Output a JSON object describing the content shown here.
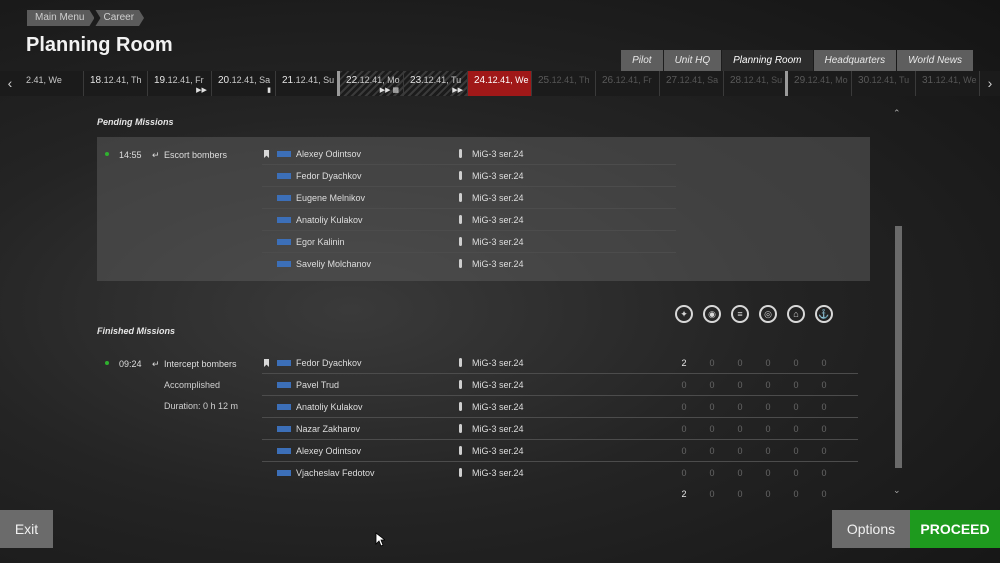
{
  "breadcrumb": [
    "Main Menu",
    "Career"
  ],
  "title": "Planning Room",
  "tabs": [
    {
      "label": "Pilot",
      "active": false
    },
    {
      "label": "Unit HQ",
      "active": false
    },
    {
      "label": "Planning Room",
      "active": true
    },
    {
      "label": "Headquarters",
      "active": false
    },
    {
      "label": "World News",
      "active": false
    }
  ],
  "timeline": {
    "days": [
      {
        "num": "",
        "rest": "2.41, We"
      },
      {
        "num": "18",
        "rest": ".12.41, Th"
      },
      {
        "num": "19",
        "rest": ".12.41, Fr"
      },
      {
        "num": "20",
        "rest": ".12.41, Sa"
      },
      {
        "num": "21",
        "rest": ".12.41, Su"
      },
      {
        "num": "22",
        "rest": ".12.41, Mo"
      },
      {
        "num": "23",
        "rest": ".12.41, Tu"
      },
      {
        "num": "24",
        "rest": ".12.41, We"
      },
      {
        "num": "25",
        "rest": ".12.41, Th"
      },
      {
        "num": "26",
        "rest": ".12.41, Fr"
      },
      {
        "num": "27",
        "rest": ".12.41, Sa"
      },
      {
        "num": "28",
        "rest": ".12.41, Su"
      },
      {
        "num": "29",
        "rest": ".12.41, Mo"
      },
      {
        "num": "30",
        "rest": ".12.41, Tu"
      },
      {
        "num": "31",
        "rest": ".12.41, We"
      }
    ]
  },
  "pending": {
    "title": "Pending Missions",
    "time": "14:55",
    "name": "Escort bombers",
    "pilots": [
      {
        "name": "Alexey Odintsov",
        "plane": "MiG-3 ser.24"
      },
      {
        "name": "Fedor Dyachkov",
        "plane": "MiG-3 ser.24"
      },
      {
        "name": "Eugene Melnikov",
        "plane": "MiG-3 ser.24"
      },
      {
        "name": "Anatoliy Kulakov",
        "plane": "MiG-3 ser.24"
      },
      {
        "name": "Egor Kalinin",
        "plane": "MiG-3 ser.24"
      },
      {
        "name": "Saveliy Molchanov",
        "plane": "MiG-3 ser.24"
      }
    ]
  },
  "finished": {
    "title": "Finished Missions",
    "time": "09:24",
    "name": "Intercept bombers",
    "status": "Accomplished",
    "duration": "Duration: 0 h 12 m",
    "stat_icons": [
      "aircraft-kills-icon",
      "ground-vehicle-kills-icon",
      "armor-kills-icon",
      "target-kills-icon",
      "building-kills-icon",
      "ship-kills-icon"
    ],
    "pilots": [
      {
        "name": "Fedor Dyachkov",
        "plane": "MiG-3 ser.24",
        "stats": [
          "2",
          "0",
          "0",
          "0",
          "0",
          "0"
        ]
      },
      {
        "name": "Pavel Trud",
        "plane": "MiG-3 ser.24",
        "stats": [
          "0",
          "0",
          "0",
          "0",
          "0",
          "0"
        ]
      },
      {
        "name": "Anatoliy Kulakov",
        "plane": "MiG-3 ser.24",
        "stats": [
          "0",
          "0",
          "0",
          "0",
          "0",
          "0"
        ]
      },
      {
        "name": "Nazar Zakharov",
        "plane": "MiG-3 ser.24",
        "stats": [
          "0",
          "0",
          "0",
          "0",
          "0",
          "0"
        ]
      },
      {
        "name": "Alexey Odintsov",
        "plane": "MiG-3 ser.24",
        "stats": [
          "0",
          "0",
          "0",
          "0",
          "0",
          "0"
        ]
      },
      {
        "name": "Vjacheslav Fedotov",
        "plane": "MiG-3 ser.24",
        "stats": [
          "0",
          "0",
          "0",
          "0",
          "0",
          "0"
        ]
      }
    ],
    "totals": [
      "2",
      "0",
      "0",
      "0",
      "0",
      "0"
    ]
  },
  "buttons": {
    "exit": "Exit",
    "options": "Options",
    "proceed": "PROCEED"
  },
  "colors": {
    "current_day": "#a01818",
    "proceed": "#1e9a1e",
    "mission_dot": "#2fb12f",
    "flag": "#3c6fb8"
  }
}
